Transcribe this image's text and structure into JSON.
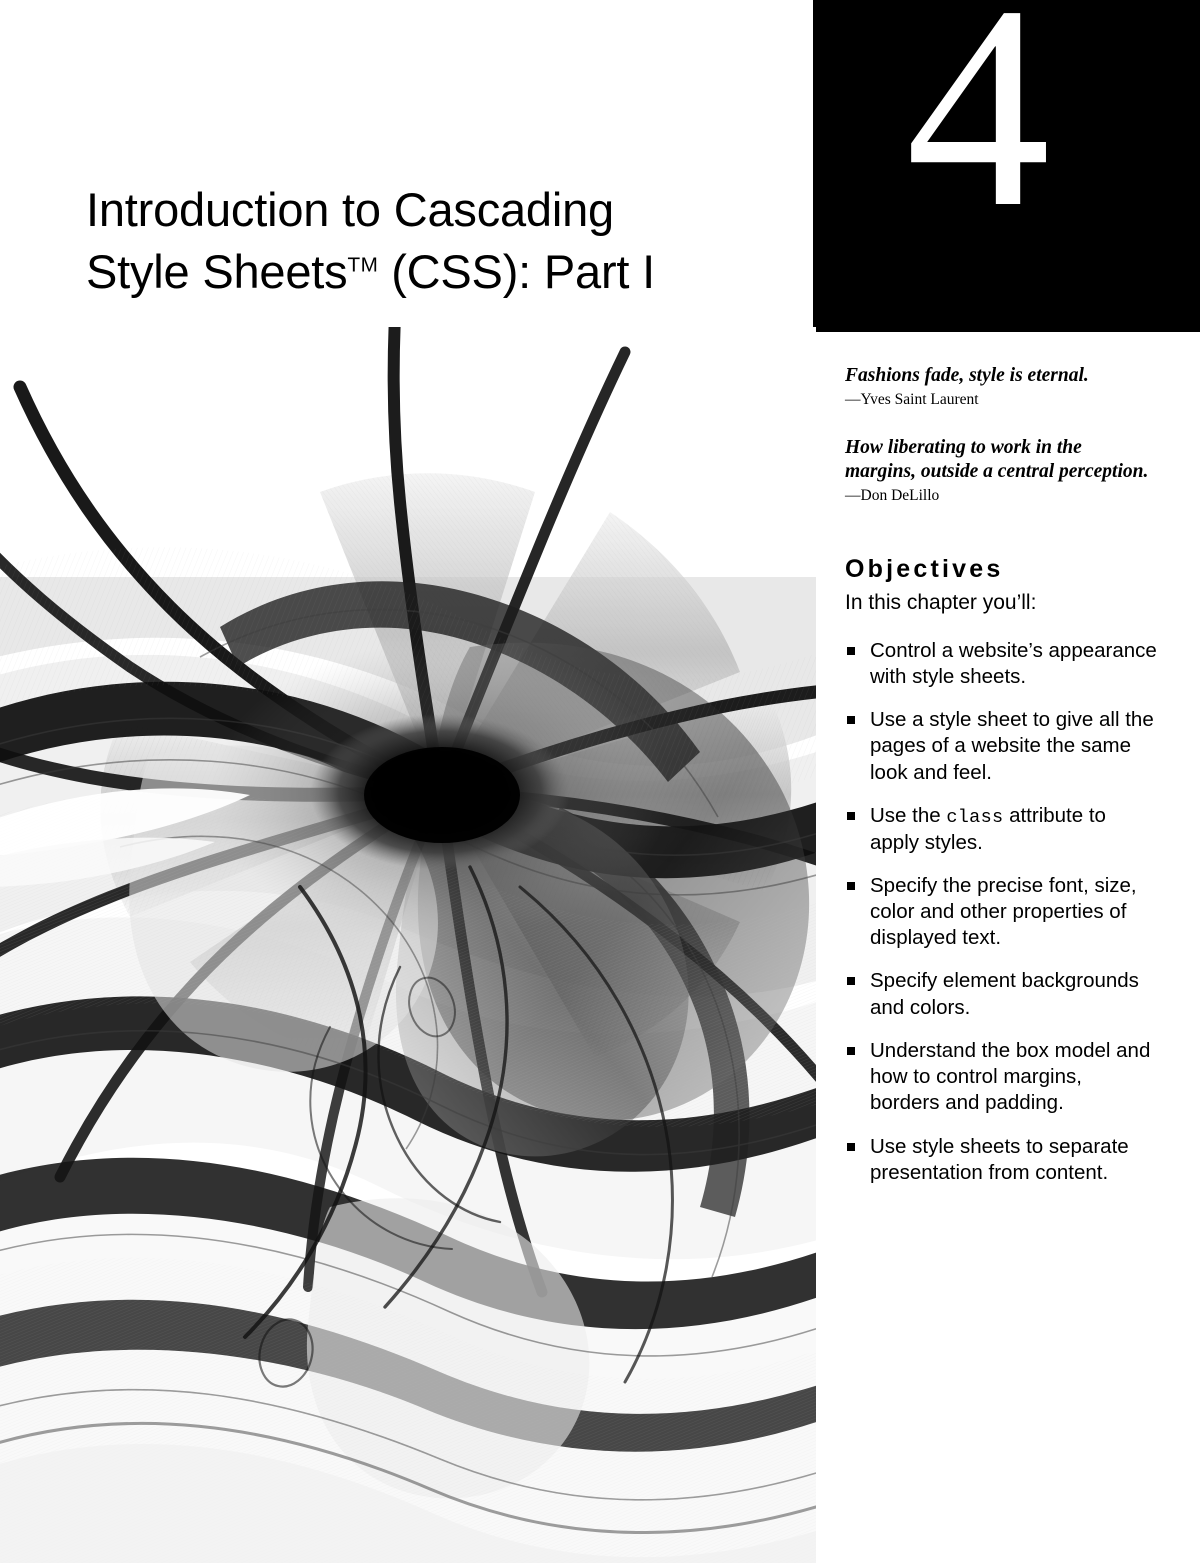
{
  "chapter": {
    "number": "4",
    "title_line_1": "Introduction to Cascading",
    "title_line_2_prefix": "Style Sheets",
    "title_trademark": "TM",
    "title_line_2_suffix": " (CSS): Part I",
    "title_full": "Introduction to Cascading Style Sheets™ (CSS): Part I"
  },
  "quotes": [
    {
      "text": "Fashions fade, style is eternal.",
      "attribution": "—Yves Saint Laurent"
    },
    {
      "text": "How liberating to work in the margins, outside a central perception.",
      "attribution": "—Don DeLillo"
    }
  ],
  "objectives": {
    "heading": "Objectives",
    "intro": "In this chapter you’ll:",
    "items": [
      {
        "pre": "Control a website’s appearance with style sheets.",
        "code": "",
        "post": ""
      },
      {
        "pre": "Use a style sheet to give all the pages of a website the same look and feel.",
        "code": "",
        "post": ""
      },
      {
        "pre": "Use the ",
        "code": "class",
        "post": " attribute to apply styles."
      },
      {
        "pre": "Specify the precise font, size, color and other properties of displayed text.",
        "code": "",
        "post": ""
      },
      {
        "pre": "Specify element backgrounds and colors.",
        "code": "",
        "post": ""
      },
      {
        "pre": "Understand the box model and how to control margins, borders and padding.",
        "code": "",
        "post": ""
      },
      {
        "pre": "Use style sheets to separate presentation from content.",
        "code": "",
        "post": ""
      }
    ]
  },
  "artwork": {
    "name": "abstract-radial-mesh-artwork",
    "description": "Black and white abstract generative mesh of flowing ribbons radiating from a dark center",
    "ink_color": "#000000",
    "paper_color": "#ffffff"
  },
  "theme": {
    "panel_background": "#000000",
    "panel_text": "#ffffff",
    "page_background": "#ffffff",
    "body_text": "#000000"
  }
}
